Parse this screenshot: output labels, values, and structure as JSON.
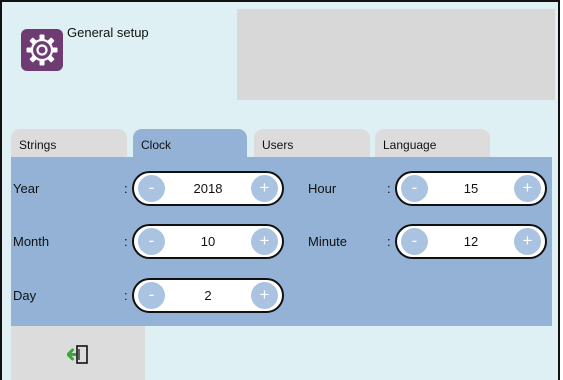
{
  "header": {
    "title": "General setup",
    "icon": "gear-icon"
  },
  "tabs": [
    {
      "label": "Strings",
      "active": false
    },
    {
      "label": "Clock",
      "active": true
    },
    {
      "label": "Users",
      "active": false
    },
    {
      "label": "Language",
      "active": false
    }
  ],
  "clock": {
    "year": {
      "label": "Year",
      "value": "2018"
    },
    "month": {
      "label": "Month",
      "value": "10"
    },
    "day": {
      "label": "Day",
      "value": "2"
    },
    "hour": {
      "label": "Hour",
      "value": "15"
    },
    "minute": {
      "label": "Minute",
      "value": "12"
    },
    "separator": ":",
    "minus_symbol": "-",
    "plus_symbol": "+"
  },
  "footer": {
    "exit_icon": "exit-icon"
  },
  "colors": {
    "background": "#dff0f4",
    "accent": "#6e3b73",
    "panel": "#93b2d5",
    "tab_inactive": "#dcdcdc",
    "button": "#a9c3e1"
  }
}
